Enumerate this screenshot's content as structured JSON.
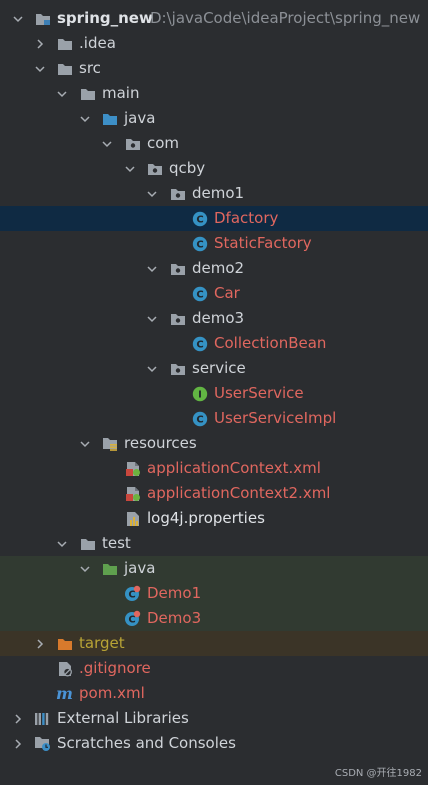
{
  "tree": {
    "root": {
      "name": "spring_new",
      "path": "D:\\javaCode\\ideaProject\\spring_new"
    },
    "idea": "idea",
    "src": "src",
    "main": "main",
    "java": "java",
    "com": "com",
    "qcby": "qcby",
    "demo1": "demo1",
    "dfactory": "Dfactory",
    "staticfactory": "StaticFactory",
    "demo2": "demo2",
    "car": "Car",
    "demo3": "demo3",
    "collectionbean": "CollectionBean",
    "service": "service",
    "userservice": "UserService",
    "userserviceimpl": "UserServiceImpl",
    "resources": "resources",
    "appctx": "applicationContext.xml",
    "appctx2": "applicationContext2.xml",
    "log4j": "log4j.properties",
    "test": "test",
    "testjava": "java",
    "demo1test": "Demo1",
    "demo3test": "Demo3",
    "target": "target",
    "gitignore": ".gitignore",
    "pom": "pom.xml",
    "extlibs": "External Libraries",
    "scratches": "Scratches and Consoles"
  },
  "watermark": "CSDN @开往1982",
  "colors": {
    "background": "#2b2d30",
    "selected_row": "#0f2a43",
    "test_row": "#313a31",
    "target_row": "#3b3427",
    "modified_file": "#e0675f",
    "excluded_folder": "#b8a335",
    "class_icon": "#3592c4",
    "interface_icon": "#62b543"
  }
}
